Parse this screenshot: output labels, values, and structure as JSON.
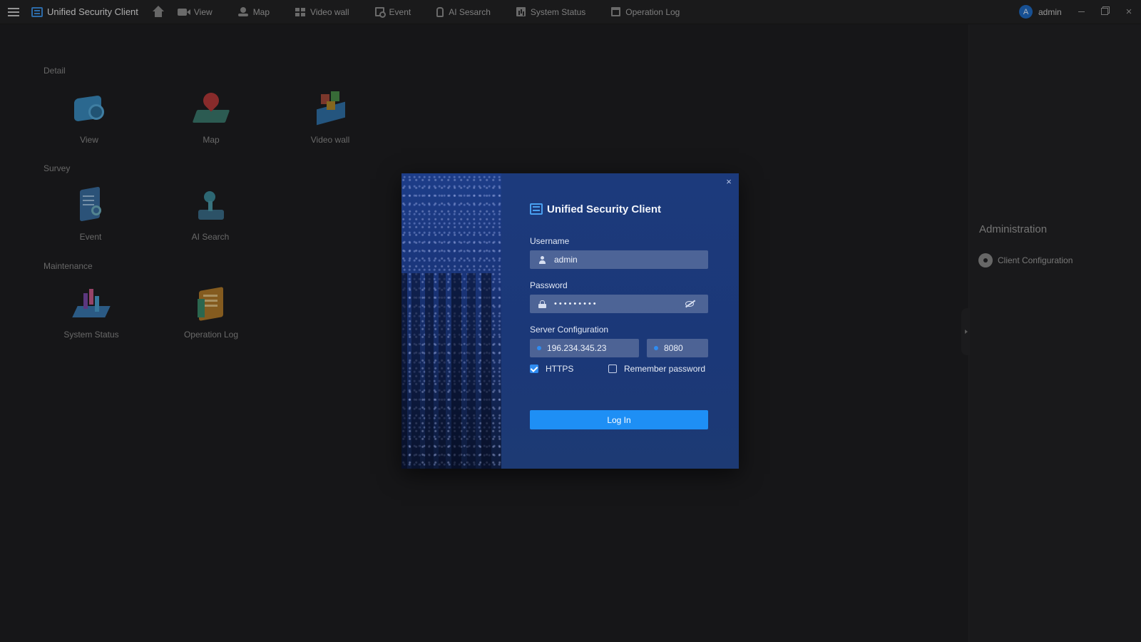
{
  "topbar": {
    "app_title": "Unified Security Client",
    "nav": [
      {
        "label": "View",
        "icon": "camera-icon"
      },
      {
        "label": "Map",
        "icon": "map-pin-icon"
      },
      {
        "label": "Video wall",
        "icon": "grid-icon"
      },
      {
        "label": "Event",
        "icon": "event-icon"
      },
      {
        "label": "AI Sesarch",
        "icon": "ai-search-icon"
      },
      {
        "label": "System Status",
        "icon": "chart-icon"
      },
      {
        "label": "Operation Log",
        "icon": "log-icon"
      }
    ],
    "user_initial": "A",
    "user_name": "admin"
  },
  "main": {
    "sections": [
      {
        "title": "Detail",
        "tiles": [
          "View",
          "Map",
          "Video wall"
        ]
      },
      {
        "title": "Survey",
        "tiles": [
          "Event",
          "AI Search"
        ]
      },
      {
        "title": "Maintenance",
        "tiles": [
          "System Status",
          "Operation Log"
        ]
      }
    ]
  },
  "admin_panel": {
    "title": "Administration",
    "items": [
      {
        "label": "Client Configuration",
        "icon": "gear-icon"
      }
    ]
  },
  "login": {
    "title": "Unified Security Client",
    "username_label": "Username",
    "username_value": "admin",
    "password_label": "Password",
    "password_value": "•••••••••",
    "server_label": "Server Configuration",
    "server_ip": "196.234.345.23",
    "server_port": "8080",
    "https_label": "HTTPS",
    "https_checked": true,
    "remember_label": "Remember password",
    "remember_checked": false,
    "login_button": "Log In",
    "close_glyph": "×"
  },
  "colors": {
    "accent": "#1e8ff5",
    "dialog_bg": "#1c3a78",
    "app_bg": "#1e1e20"
  }
}
